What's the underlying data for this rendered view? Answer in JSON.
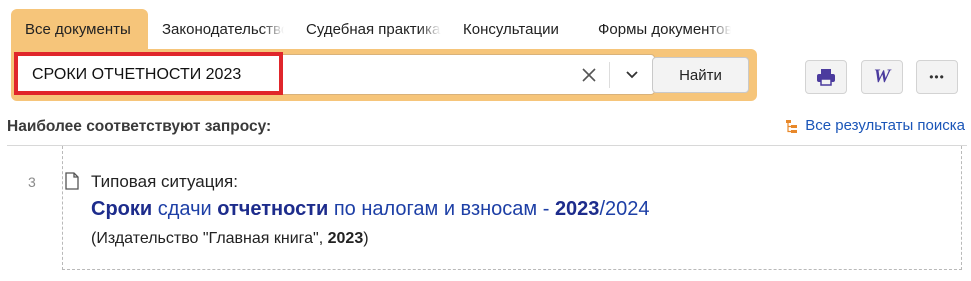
{
  "tabs": [
    {
      "label": "Все документы"
    },
    {
      "label": "Законодательство"
    },
    {
      "label": "Судебная практика"
    },
    {
      "label": "Консультации"
    },
    {
      "label": "Формы документов"
    }
  ],
  "search": {
    "value": "СРОКИ ОТЧЕТНОСТИ 2023",
    "find_label": "Найти"
  },
  "toolbar": {
    "print_icon": "printer-icon",
    "word_icon": "word-export-icon",
    "word_glyph": "W",
    "more_glyph": "•••"
  },
  "results": {
    "heading": "Наиболее соответствуют запросу:",
    "all_results_label": "Все результаты поиска",
    "items": [
      {
        "number": "3",
        "type": "Типовая ситуация:",
        "title_parts": {
          "p1": "Сроки",
          "p2": " сдачи ",
          "p3": "отчетности",
          "p4": " по налогам и взносам - ",
          "p5": "2023",
          "p6": "/2024"
        },
        "source_parts": {
          "s1": "(Издательство \"Главная книга\", ",
          "s2": "2023",
          "s3": ")"
        }
      }
    ]
  },
  "colors": {
    "accent": "#f6c57a",
    "highlight_border": "#e0262b",
    "link": "#1d3fa6"
  }
}
